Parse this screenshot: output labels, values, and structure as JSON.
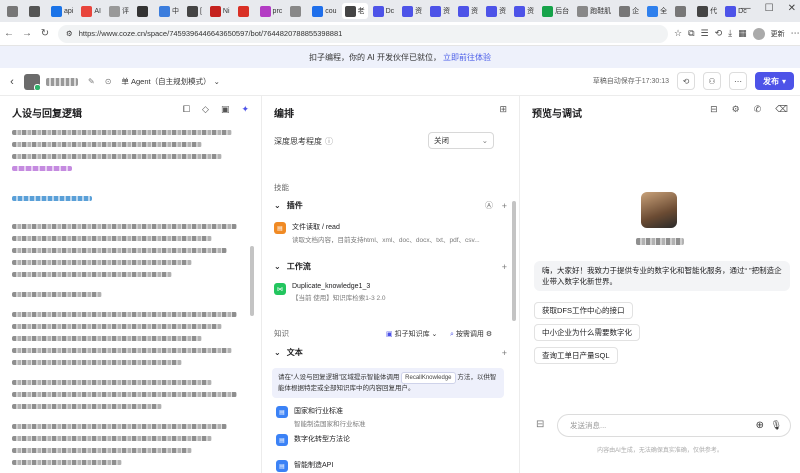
{
  "browser": {
    "tabs": [
      {
        "label": "",
        "color": "#777"
      },
      {
        "label": "",
        "color": "#555"
      },
      {
        "label": "api",
        "color": "#1a73e8"
      },
      {
        "label": "AI",
        "color": "#e8453c"
      },
      {
        "label": "评",
        "color": "#999"
      },
      {
        "label": "",
        "color": "#333"
      },
      {
        "label": "中",
        "color": "#3b7ddd"
      },
      {
        "label": "[",
        "color": "#444"
      },
      {
        "label": "Ni",
        "color": "#c5221f"
      },
      {
        "label": "",
        "color": "#d93025"
      },
      {
        "label": "prc",
        "color": "#b33cc4"
      },
      {
        "label": "",
        "color": "#888"
      },
      {
        "label": "cou",
        "color": "#1f6feb"
      },
      {
        "label": "老",
        "color": "#444"
      },
      {
        "label": "Dc",
        "color": "#4d53e8"
      },
      {
        "label": "资",
        "color": "#4d53e8"
      },
      {
        "label": "资",
        "color": "#4d53e8"
      },
      {
        "label": "资",
        "color": "#4d53e8"
      },
      {
        "label": "资",
        "color": "#4d53e8"
      },
      {
        "label": "资",
        "color": "#4d53e8"
      },
      {
        "label": "后台",
        "color": "#16a34a"
      },
      {
        "label": "跑鞋肌",
        "color": "#888"
      },
      {
        "label": "企",
        "color": "#777"
      },
      {
        "label": "全",
        "color": "#2f80ed"
      },
      {
        "label": "",
        "color": "#777"
      },
      {
        "label": "代",
        "color": "#444"
      },
      {
        "label": "Dc",
        "color": "#4d53e8"
      }
    ],
    "url": "https://www.coze.cn/space/7459396446643650597/bot/7644820788855398881",
    "update_label": "更新"
  },
  "banner": {
    "text": "扣子编程，你的 AI 开发伙伴已就位，",
    "link": "立即前往体验"
  },
  "header": {
    "agent_mode": "单 Agent（自主规划模式）",
    "saved": "草稿自动保存于17:30:13",
    "publish": "发布"
  },
  "left": {
    "title": "人设与回复逻辑"
  },
  "mid": {
    "title": "编排",
    "depth_label": "深度思考程度",
    "depth_value": "关闭",
    "skills": "技能",
    "plugins": "插件",
    "plugin_name": "文件读取 / read",
    "plugin_desc": "读取文档内容，目前支持html、xml、doc、docx、txt、pdf、csv...",
    "workflow": "工作流",
    "workflow_name": "Duplicate_knowledge1_3",
    "workflow_desc": "【当前                使用】知识库检索1-3 2.0",
    "knowledge": "知识",
    "kb_source": "扣子知识库",
    "kb_call": "按需调用",
    "text": "文本",
    "hint": "请在“人设与回复逻辑”区域提示智能体调用",
    "hint_tag": "RecallKnowledge",
    "hint_tail": "方法，以供智能体根据特定或全部知识库中的内容回复用户。",
    "kb_items": [
      {
        "title": "国家和行业标准",
        "desc": "智能制造国家和行业标准"
      },
      {
        "title": "数字化转型方法论",
        "desc": ""
      },
      {
        "title": "智能制造API",
        "desc": ""
      }
    ]
  },
  "right": {
    "title": "预览与调试",
    "greeting": "嗨，大家好！我致力于提供专业的数字化和智能化服务，通过“         ”把制造企业带入数字化新世界。",
    "suggestions": [
      "获取DFS工作中心的接口",
      "中小企业为什么需要数字化",
      "查询工单日产量SQL"
    ],
    "input_placeholder": "发送消息...",
    "disclaimer": "内容由AI生成，无法确保真实准确，仅供参考。"
  }
}
